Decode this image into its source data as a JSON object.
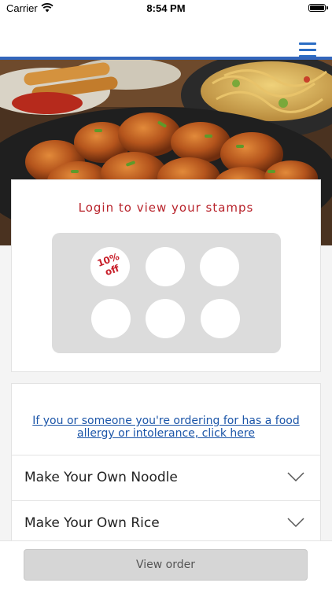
{
  "status_bar": {
    "carrier": "Carrier",
    "time": "8:54 PM",
    "icons": [
      "wifi-icon",
      "battery-icon"
    ]
  },
  "header": {
    "menu_icon": "hamburger-menu-icon",
    "accent_color": "#3366bb"
  },
  "stamps": {
    "title": "Login to view your stamps",
    "title_color": "#b8232b",
    "count": 6,
    "first_stamp_label": "10% off"
  },
  "allergy": {
    "link_text": "If you or someone you're ordering for has a food allergy or intolerance, click here"
  },
  "categories": [
    {
      "label": "Make Your Own Noodle"
    },
    {
      "label": "Make Your Own Rice"
    }
  ],
  "footer": {
    "view_order_label": "View order"
  }
}
